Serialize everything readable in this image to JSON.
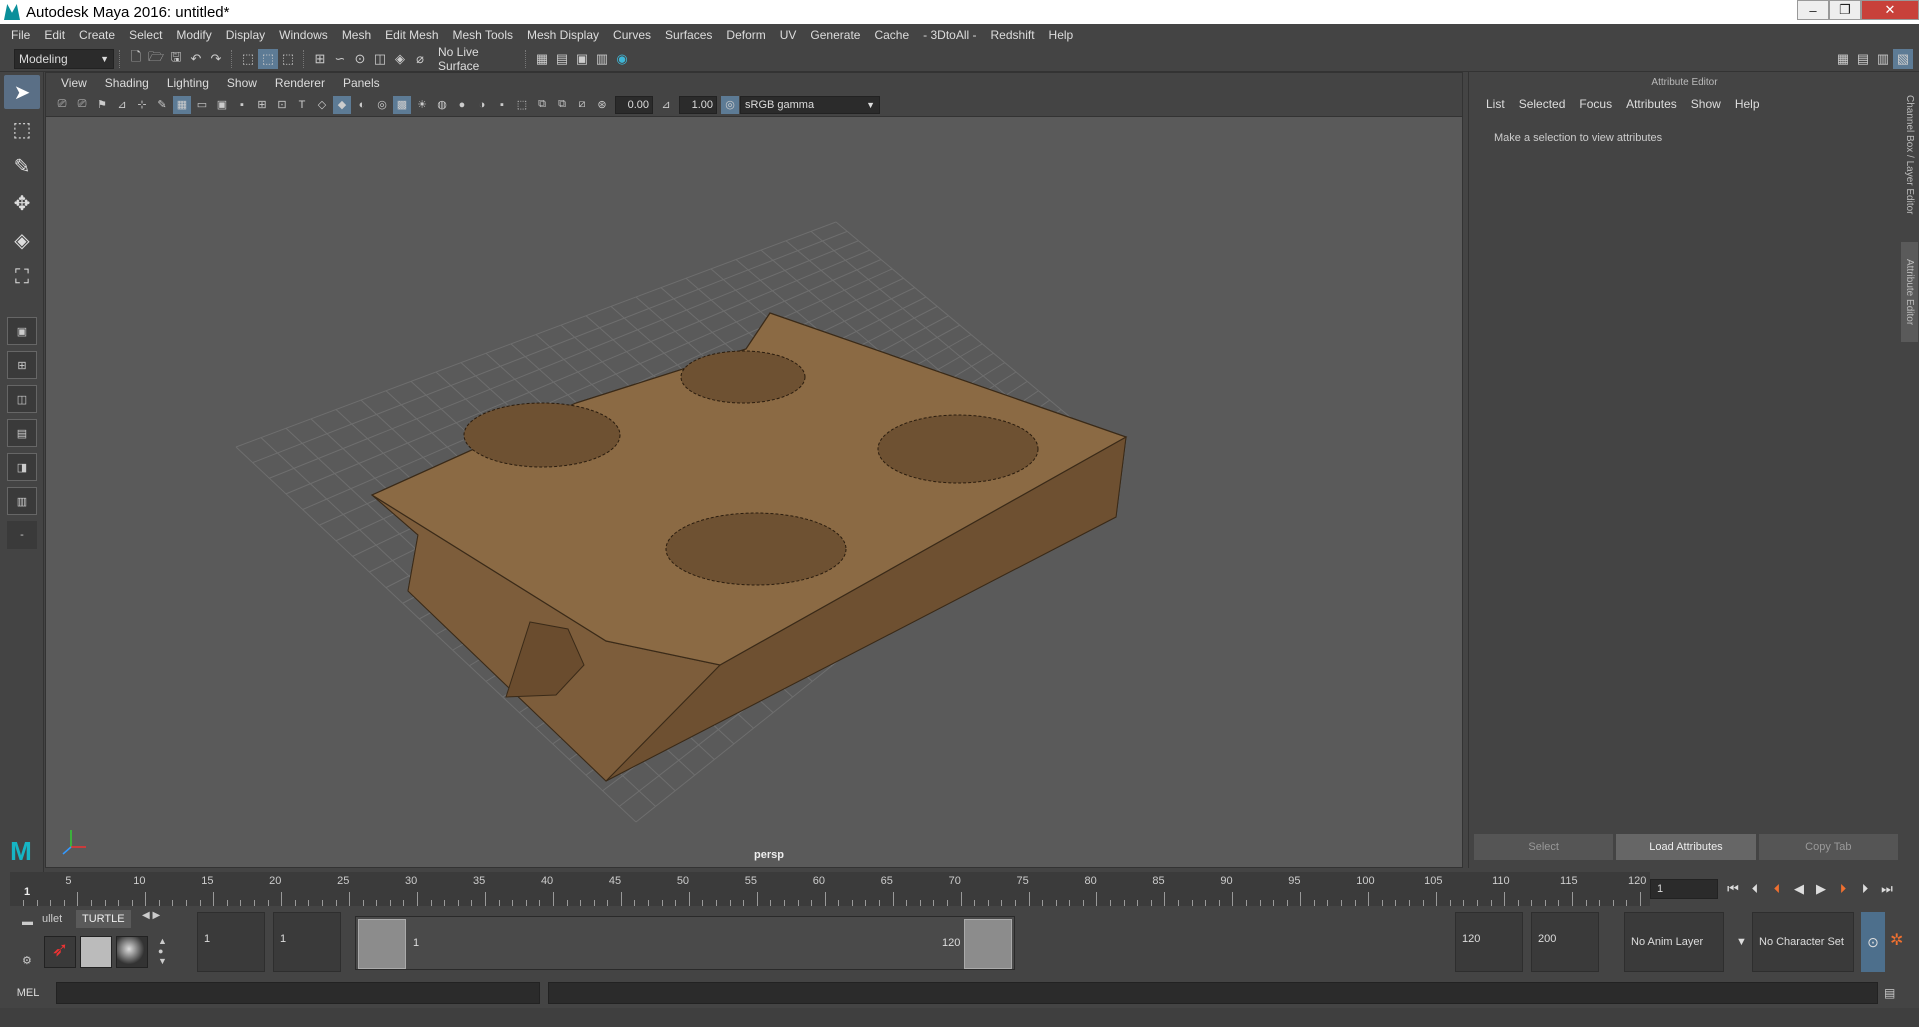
{
  "window": {
    "title": "Autodesk Maya 2016: untitled*",
    "minimize": "–",
    "maximize": "❐",
    "close": "✕"
  },
  "menubar": [
    "File",
    "Edit",
    "Create",
    "Select",
    "Modify",
    "Display",
    "Windows",
    "Mesh",
    "Edit Mesh",
    "Mesh Tools",
    "Mesh Display",
    "Curves",
    "Surfaces",
    "Deform",
    "UV",
    "Generate",
    "Cache",
    "- 3DtoAll -",
    "Redshift",
    "Help"
  ],
  "status": {
    "menu_set": "Modeling",
    "live_surface": "No Live Surface"
  },
  "viewport": {
    "menus": [
      "View",
      "Shading",
      "Lighting",
      "Show",
      "Renderer",
      "Panels"
    ],
    "exposure": "0.00",
    "gamma": "1.00",
    "color_space": "sRGB gamma",
    "camera_label": "persp"
  },
  "attribute_editor": {
    "title": "Attribute Editor",
    "menus": [
      "List",
      "Selected",
      "Focus",
      "Attributes",
      "Show",
      "Help"
    ],
    "message": "Make a selection to view attributes",
    "buttons": {
      "select": "Select",
      "load": "Load Attributes",
      "copy": "Copy Tab"
    },
    "side_tabs": {
      "channel_box": "Channel Box / Layer Editor",
      "attribute_editor": "Attribute Editor"
    }
  },
  "timeline": {
    "ticks": [
      "5",
      "10",
      "15",
      "20",
      "25",
      "30",
      "35",
      "40",
      "45",
      "50",
      "55",
      "60",
      "65",
      "70",
      "75",
      "80",
      "85",
      "90",
      "95",
      "100",
      "105",
      "110",
      "115",
      "120"
    ],
    "current_frame_marker": "1",
    "current_frame_field": "1"
  },
  "range": {
    "shelf_tabs": [
      "ullet",
      "TURTLE"
    ],
    "start_time": "1",
    "playback_start": "1",
    "range_start_label": "1",
    "range_end_label": "120",
    "playback_end": "120",
    "end_time": "200",
    "anim_layer": "No Anim Layer",
    "character_set": "No Character Set"
  },
  "command": {
    "lang": "MEL"
  },
  "colors": {
    "accent": "#5d7b95",
    "maya_teal": "#16b5c4",
    "close_red": "#c8413a",
    "cardboard": "#8b6a44",
    "viewport_bg": "#5a5a5a"
  },
  "icons": {
    "toolbox": [
      "select-tool-icon",
      "lasso-tool-icon",
      "paint-select-icon",
      "move-tool-icon",
      "rotate-tool-icon",
      "scale-tool-icon"
    ],
    "playback": [
      "go-to-start-icon",
      "step-back-icon",
      "step-back-key-icon",
      "play-backwards-icon",
      "play-forwards-icon",
      "step-forward-key-icon",
      "step-forward-icon",
      "go-to-end-icon"
    ]
  }
}
